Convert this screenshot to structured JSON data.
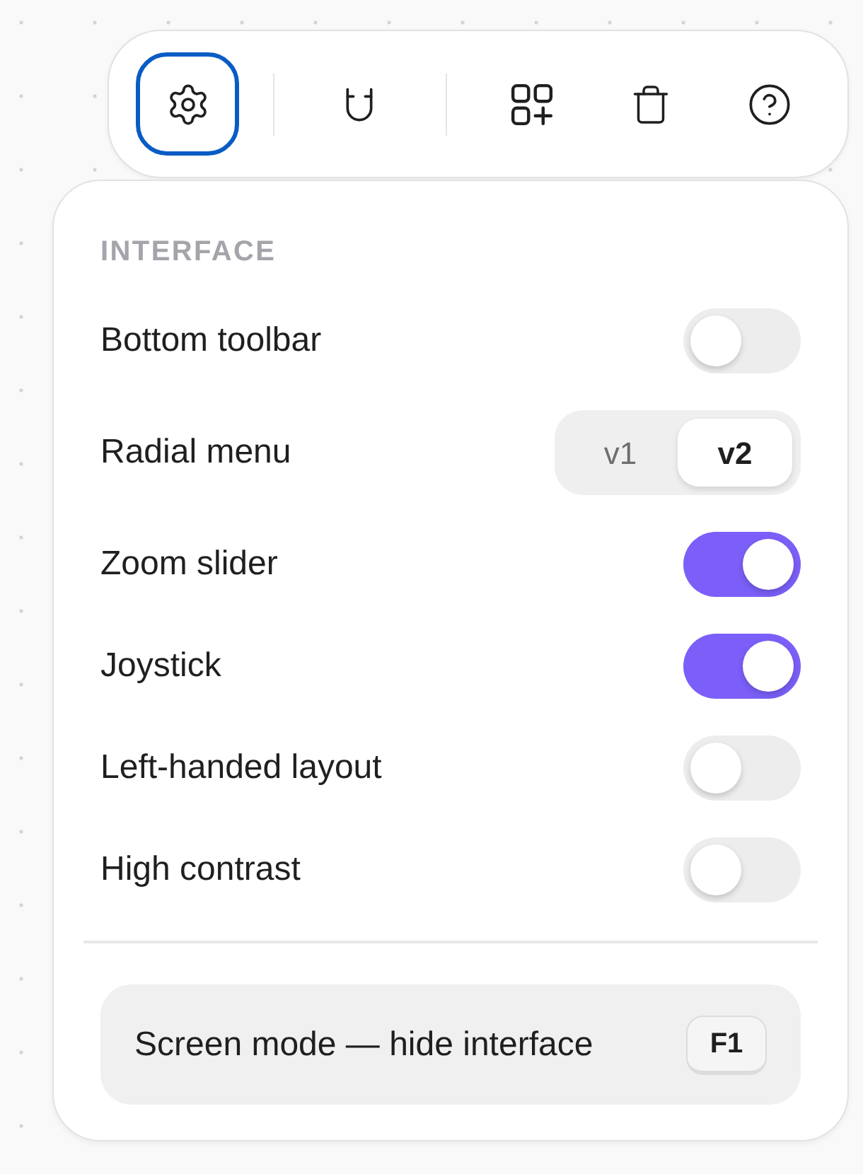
{
  "toolbar": {
    "tool_groups": [
      [
        {
          "selected": true
        }
      ],
      [
        {
          "selected": false
        }
      ],
      [
        {
          "selected": false
        },
        {
          "selected": false
        },
        {
          "selected": false
        }
      ]
    ]
  },
  "panel": {
    "heading": "INTERFACE",
    "settings": [
      {
        "kind": "toggle",
        "label": "Bottom toolbar",
        "on": false
      },
      {
        "kind": "segmented",
        "label": "Radial menu",
        "options": [
          {
            "label": "v1",
            "selected": false
          },
          {
            "label": "v2",
            "selected": true
          }
        ]
      },
      {
        "kind": "toggle",
        "label": "Zoom slider",
        "on": true
      },
      {
        "kind": "toggle",
        "label": "Joystick",
        "on": true
      },
      {
        "kind": "toggle",
        "label": "Left-handed layout",
        "on": false
      },
      {
        "kind": "toggle",
        "label": "High contrast",
        "on": false
      }
    ],
    "action": {
      "label": "Screen mode — hide interface",
      "shortcut": "F1"
    }
  }
}
